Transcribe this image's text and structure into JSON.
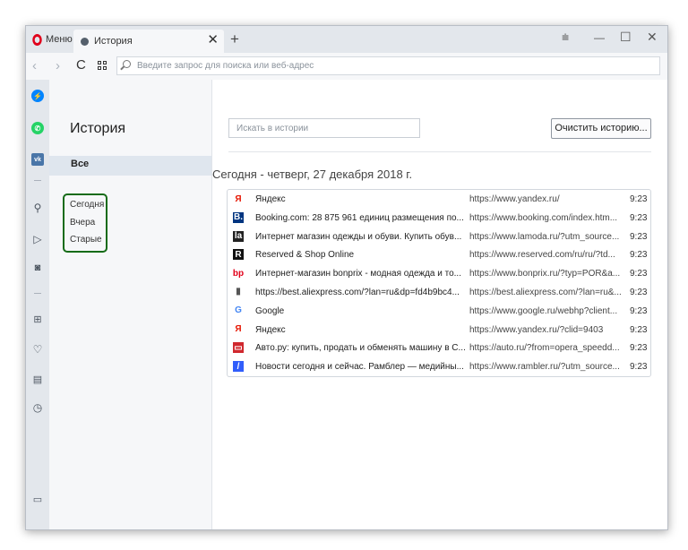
{
  "titlebar": {
    "menu_label": "Меню",
    "tab_title": "История",
    "tab_close": "✕",
    "new_tab": "+",
    "filter_icon": "⩧",
    "minimize": "—",
    "maximize": "☐",
    "close": "✕"
  },
  "addressbar": {
    "back": "‹",
    "forward": "›",
    "reload": "C",
    "placeholder": "Введите запрос для поиска или веб-адрес"
  },
  "sidebar": {
    "icons": [
      "messenger-icon",
      "whatsapp-icon",
      "vk-icon",
      "search-icon",
      "send-icon",
      "camera-icon",
      "speed-dial-icon",
      "heart-icon",
      "news-icon",
      "history-icon",
      "panel-toggle-icon"
    ],
    "messenger_color": "#0084ff",
    "whatsapp_color": "#25d366",
    "vk_color": "#4a76a8"
  },
  "left_panel": {
    "title": "История",
    "all": "Все",
    "items": [
      "Сегодня",
      "Вчера",
      "Старые"
    ],
    "highlight_color": "#156b17"
  },
  "main": {
    "search_placeholder": "Искать в истории",
    "clear_button": "Очистить историю...",
    "date_heading": "Сегодня - четверг, 27 декабря 2018 г.",
    "rows": [
      {
        "icon": "Я",
        "icon_color": "#e61400",
        "icon_bg": "transparent",
        "title": "Яндекс",
        "url": "https://www.yandex.ru/",
        "time": "9:23"
      },
      {
        "icon": "B.",
        "icon_color": "#ffffff",
        "icon_bg": "#003580",
        "title": "Booking.com: 28 875 961 единиц размещения по...",
        "url": "https://www.booking.com/index.htm...",
        "time": "9:23"
      },
      {
        "icon": "la",
        "icon_color": "#ffffff",
        "icon_bg": "#222222",
        "title": "Интернет магазин одежды и обуви. Купить обув...",
        "url": "https://www.lamoda.ru/?utm_source...",
        "time": "9:23"
      },
      {
        "icon": "R",
        "icon_color": "#ffffff",
        "icon_bg": "#111111",
        "title": "Reserved & Shop Online",
        "url": "https://www.reserved.com/ru/ru/?td...",
        "time": "9:23"
      },
      {
        "icon": "bp",
        "icon_color": "#e2001a",
        "icon_bg": "transparent",
        "title": "Интернет-магазин bonprix - модная одежда и то...",
        "url": "https://www.bonprix.ru/?typ=POR&a...",
        "time": "9:23"
      },
      {
        "icon": "▮",
        "icon_color": "#555555",
        "icon_bg": "transparent",
        "title": "https://best.aliexpress.com/?lan=ru&dp=fd4b9bc4...",
        "url": "https://best.aliexpress.com/?lan=ru&...",
        "time": "9:23"
      },
      {
        "icon": "G",
        "icon_color": "#4285f4",
        "icon_bg": "transparent",
        "title": "Google",
        "url": "https://www.google.ru/webhp?client...",
        "time": "9:23"
      },
      {
        "icon": "Я",
        "icon_color": "#e61400",
        "icon_bg": "transparent",
        "title": "Яндекс",
        "url": "https://www.yandex.ru/?clid=9403",
        "time": "9:23"
      },
      {
        "icon": "▭",
        "icon_color": "#ffffff",
        "icon_bg": "#d0282e",
        "title": "Авто.ру: купить, продать и обменять машину в С...",
        "url": "https://auto.ru/?from=opera_speedd...",
        "time": "9:23"
      },
      {
        "icon": "/",
        "icon_color": "#ffffff",
        "icon_bg": "#315efb",
        "title": "Новости сегодня и сейчас. Рамблер — медийны...",
        "url": "https://www.rambler.ru/?utm_source...",
        "time": "9:23"
      }
    ]
  }
}
